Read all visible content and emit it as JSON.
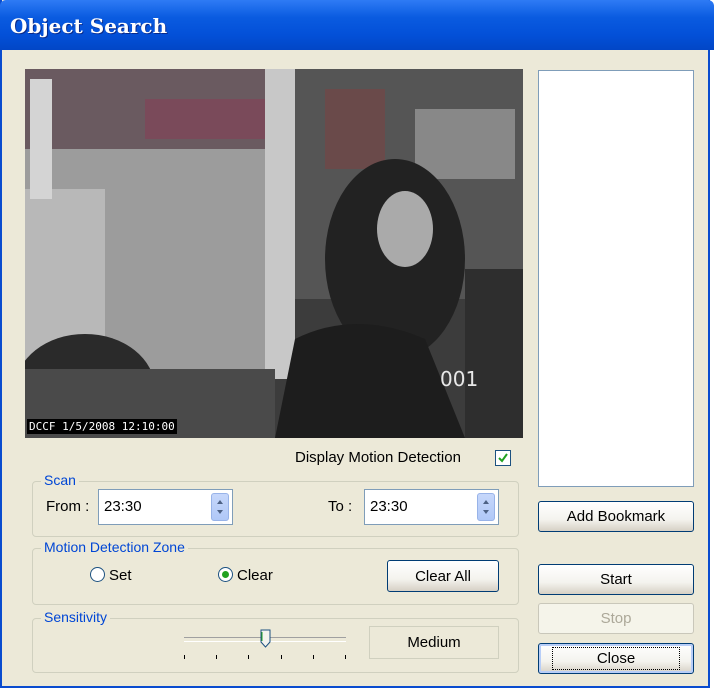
{
  "window": {
    "title": "Object Search"
  },
  "video": {
    "camera_label": "001",
    "timestamp": "DCCF 1/5/2008 12:10:00"
  },
  "display_motion": {
    "label": "Display Motion Detection",
    "checked": true
  },
  "scan": {
    "group_label": "Scan",
    "from_label": "From :",
    "from_value": "23:30",
    "to_label": "To :",
    "to_value": "23:30"
  },
  "motion_zone": {
    "group_label": "Motion Detection Zone",
    "set_label": "Set",
    "clear_label": "Clear",
    "selected": "Clear",
    "clear_all_label": "Clear All"
  },
  "sensitivity": {
    "group_label": "Sensitivity",
    "value_label": "Medium",
    "level": 0.5,
    "tick_count": 6
  },
  "side": {
    "add_bookmark_label": "Add Bookmark",
    "start_label": "Start",
    "stop_label": "Stop",
    "close_label": "Close"
  },
  "colors": {
    "title_bar": "#0A5BE0",
    "dialog_bg": "#ECE9D8",
    "group_label": "#0046D5",
    "radio_dot": "#21A121",
    "check_mark": "#21A121"
  }
}
